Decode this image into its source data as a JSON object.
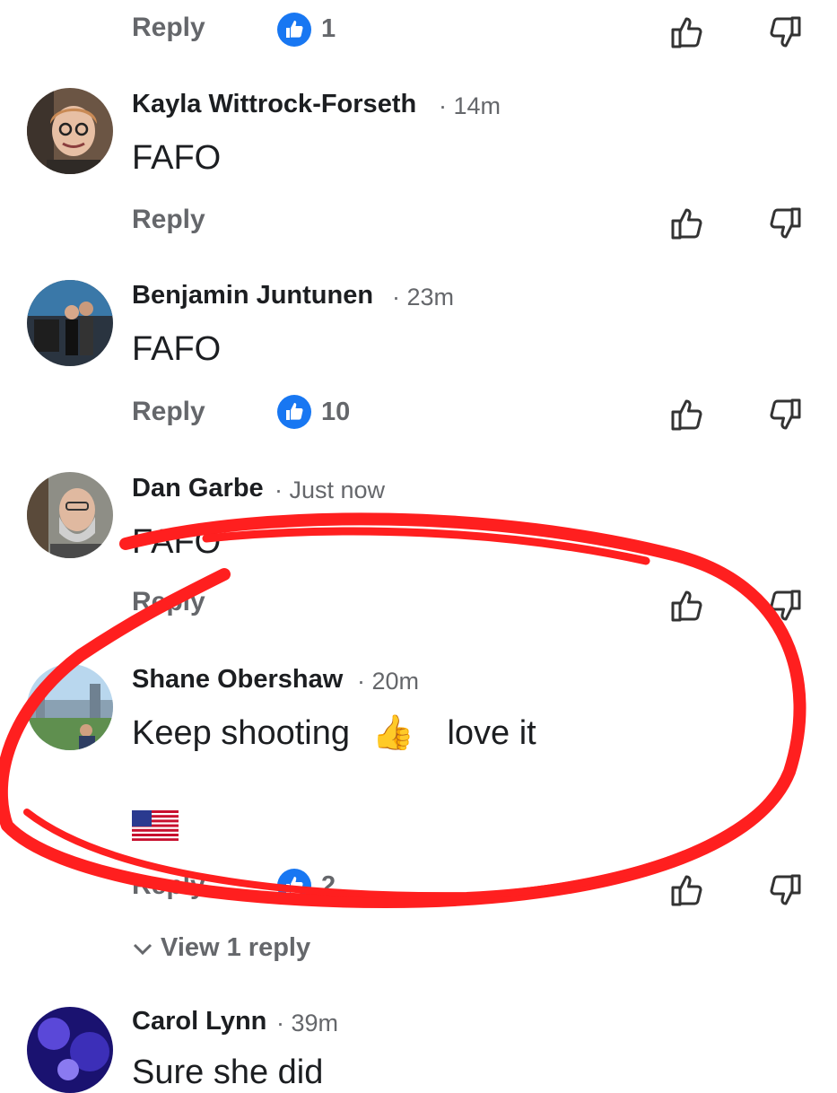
{
  "colors": {
    "accent": "#1877f2",
    "muted": "#65676b",
    "text": "#1c1e21",
    "annotation": "#ff1f1f"
  },
  "top_bar": {
    "reply_label": "Reply",
    "like_count": "1"
  },
  "comments": [
    {
      "author": "Kayla Wittrock-Forseth",
      "time": "14m",
      "text": "FAFO",
      "reply_label": "Reply"
    },
    {
      "author": "Benjamin Juntunen",
      "time": "23m",
      "text": "FAFO",
      "reply_label": "Reply",
      "like_count": "10"
    },
    {
      "author": "Dan Garbe",
      "time": "Just now",
      "text": "FAFO",
      "reply_label": "Reply"
    },
    {
      "author": "Shane Obershaw",
      "time": "20m",
      "text": "Keep shooting",
      "emoji": "👍",
      "text_after": "love it",
      "flag": "🇺🇸",
      "reply_label": "Reply",
      "like_count": "2",
      "view_replies": "View 1 reply"
    },
    {
      "author": "Carol Lynn",
      "time": "39m",
      "text": "Sure she did"
    }
  ],
  "icons": [
    "thumbs-up-icon",
    "thumbs-down-icon",
    "like-badge-icon",
    "chevron-down-icon"
  ]
}
